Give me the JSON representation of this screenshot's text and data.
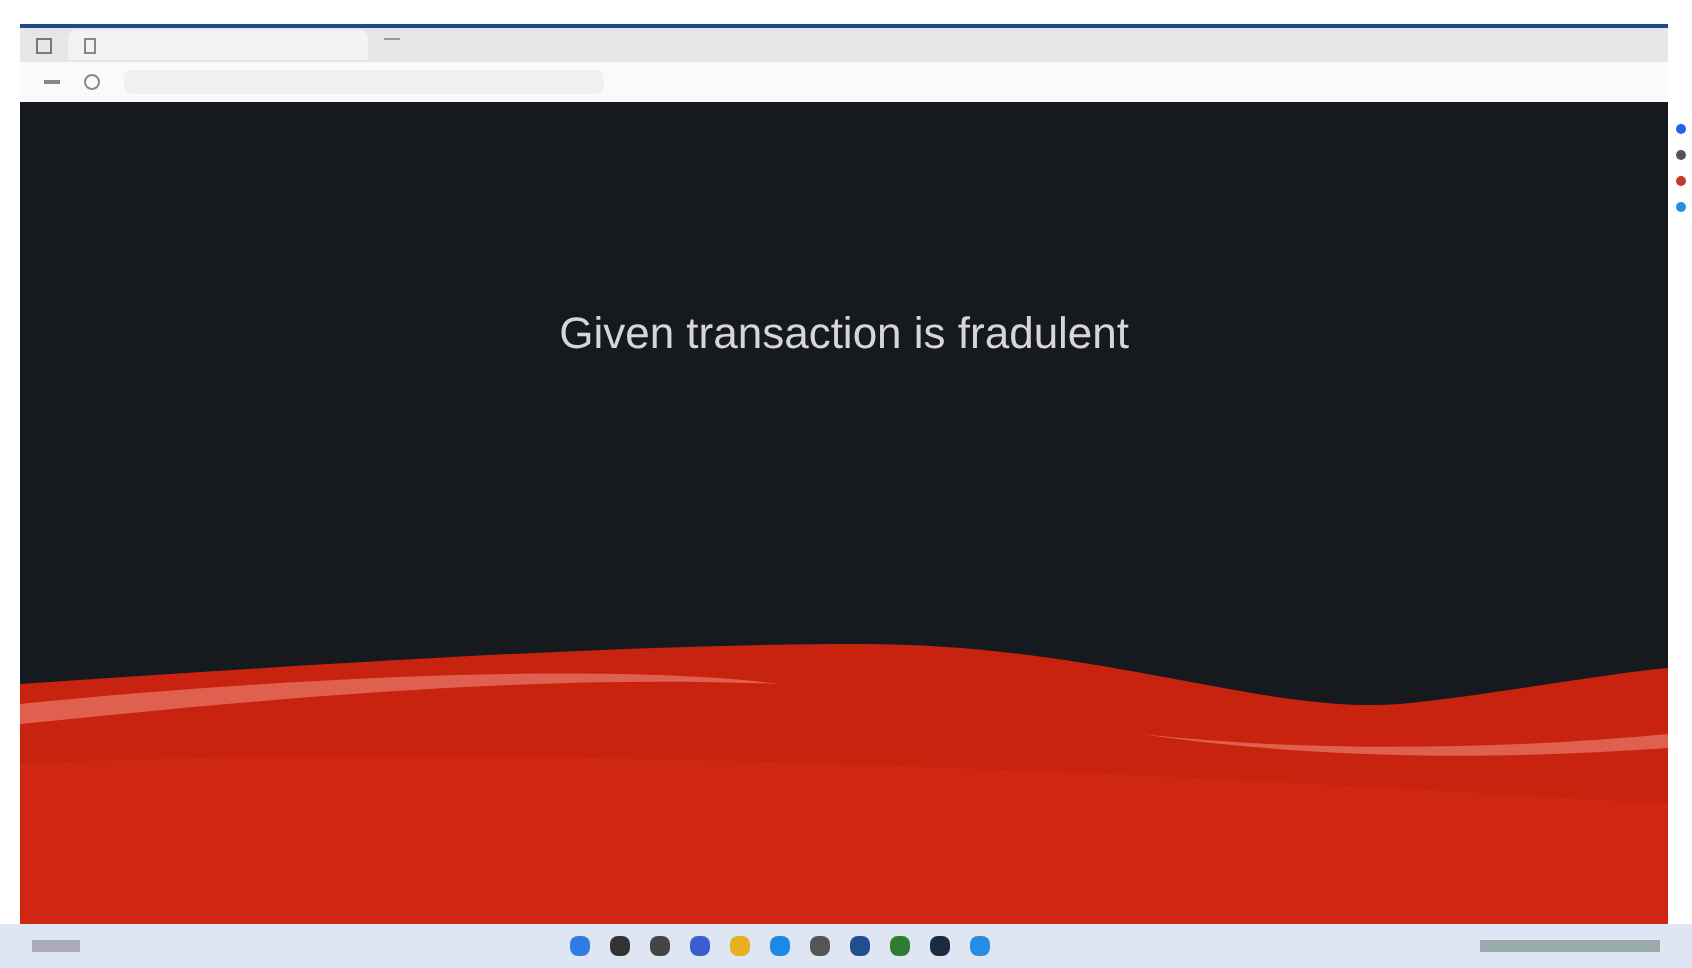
{
  "page": {
    "message": "Given transaction is fradulent"
  }
}
